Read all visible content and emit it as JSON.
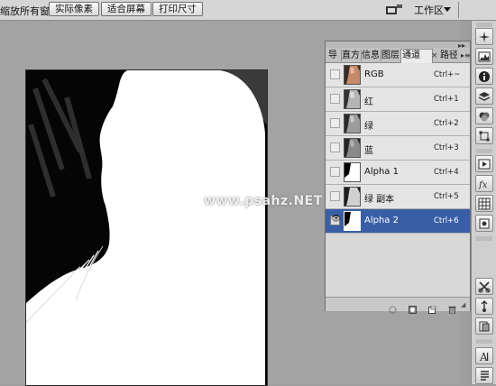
{
  "options_bar": {
    "zoom_all_label": "缩放所有窗口",
    "actual_pixels_label": "实际像素",
    "fit_screen_label": "适合屏幕",
    "print_size_label": "打印尺寸",
    "workspace_label": "工作区"
  },
  "canvas": {
    "watermark": "www.psahz.NET"
  },
  "channels_panel": {
    "tabs": [
      {
        "label": "导"
      },
      {
        "label": "直方"
      },
      {
        "label": "信息"
      },
      {
        "label": "图层"
      },
      {
        "label": "通道"
      },
      {
        "label": "路径"
      }
    ],
    "active_tab": "通道",
    "channels": [
      {
        "name": "RGB",
        "shortcut": "Ctrl+~",
        "visible": false,
        "selected": false
      },
      {
        "name": "红",
        "shortcut": "Ctrl+1",
        "visible": false,
        "selected": false
      },
      {
        "name": "绿",
        "shortcut": "Ctrl+2",
        "visible": false,
        "selected": false
      },
      {
        "name": "蓝",
        "shortcut": "Ctrl+3",
        "visible": false,
        "selected": false
      },
      {
        "name": "Alpha 1",
        "shortcut": "Ctrl+4",
        "visible": false,
        "selected": false
      },
      {
        "name": "绿 副本",
        "shortcut": "Ctrl+5",
        "visible": false,
        "selected": false
      },
      {
        "name": "Alpha 2",
        "shortcut": "Ctrl+6",
        "visible": true,
        "selected": true
      }
    ],
    "footer_icons": [
      "load-selection-icon",
      "save-selection-icon",
      "new-channel-icon",
      "delete-channel-icon"
    ]
  },
  "right_strip_icons": [
    "navigator-icon",
    "histogram-icon",
    "info-icon",
    "layers-icon",
    "channels-icon",
    "paths-icon",
    "actions-icon",
    "styles-icon",
    "swatches-icon",
    "brushes-icon",
    "clone-source-icon",
    "tool-presets-icon",
    "character-icon",
    "paragraph-icon"
  ],
  "colors": {
    "selected_row": "#3a5ea6",
    "panel_bg": "#d4d4d4",
    "canvas_bg": "#a3a3a3"
  }
}
